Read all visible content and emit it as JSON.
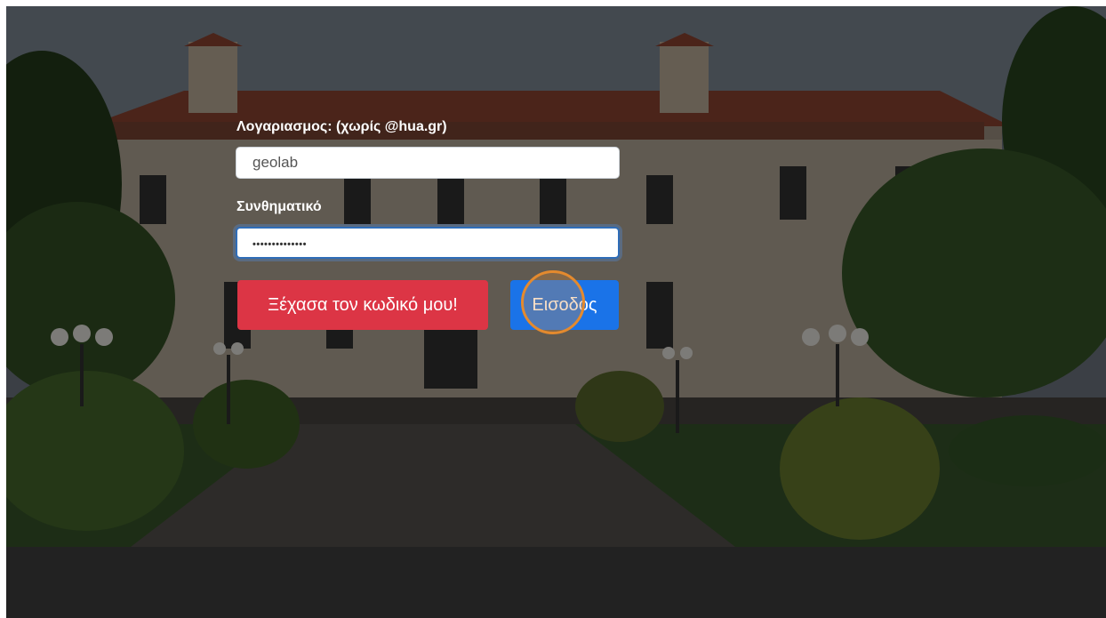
{
  "login": {
    "account_label": "Λογαριασμος: (χωρίς @hua.gr)",
    "account_value": "geolab",
    "password_label": "Συνθηματικό",
    "password_masked": "••••••••••••••",
    "forgot_button": "Ξέχασα τον κωδικό μου!",
    "login_button": "Εισοδος"
  },
  "colors": {
    "danger": "#dc3545",
    "primary": "#1a73e8",
    "focus_ring": "#2f6db8",
    "cursor_highlight": "#e48a2e",
    "footer_background": "#222222"
  }
}
